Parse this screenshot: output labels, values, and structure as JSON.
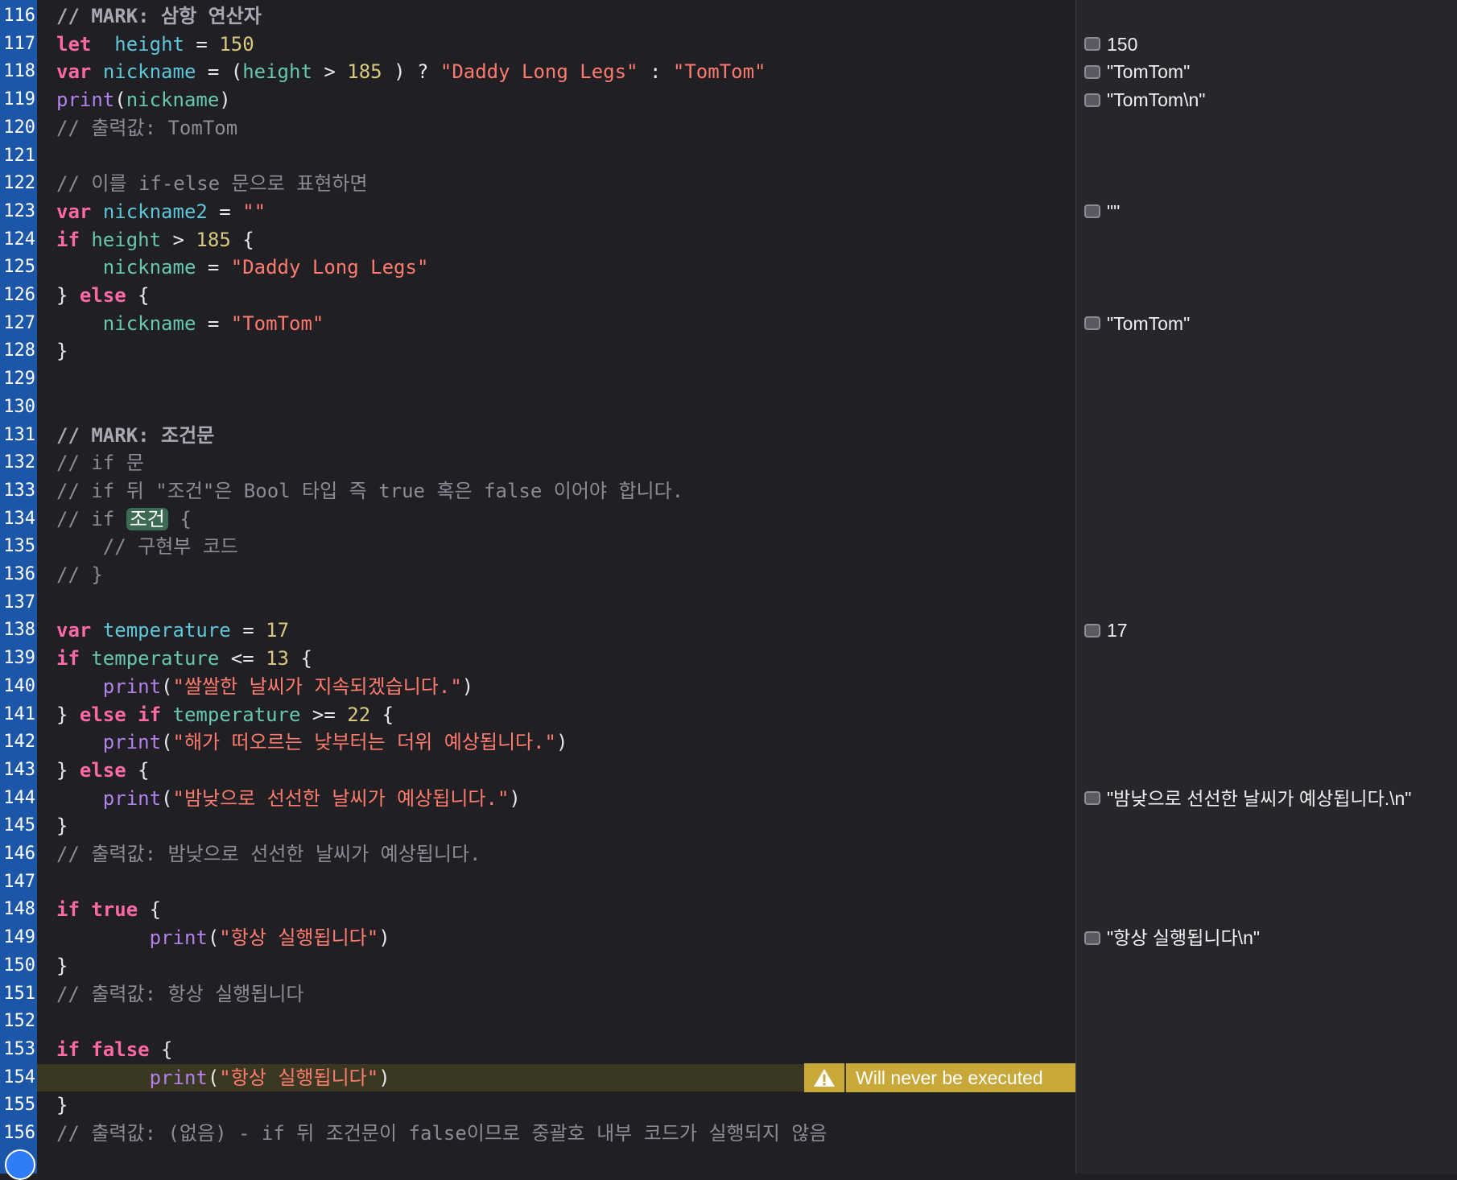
{
  "lines": [
    {
      "n": "116",
      "parts": [
        [
          "cmb",
          "// MARK: 삼항 연산자"
        ]
      ]
    },
    {
      "n": "117",
      "parts": [
        [
          "kw",
          "let"
        ],
        [
          "",
          "  "
        ],
        [
          "id",
          "height"
        ],
        [
          "",
          " = "
        ],
        [
          "num",
          "150"
        ]
      ]
    },
    {
      "n": "118",
      "parts": [
        [
          "kw",
          "var"
        ],
        [
          "",
          " "
        ],
        [
          "id",
          "nickname"
        ],
        [
          "",
          " = ("
        ],
        [
          "id2",
          "height"
        ],
        [
          "",
          " > "
        ],
        [
          "num",
          "185"
        ],
        [
          "",
          " ) ? "
        ],
        [
          "str",
          "\"Daddy Long Legs\""
        ],
        [
          "",
          " : "
        ],
        [
          "str",
          "\"TomTom\""
        ]
      ]
    },
    {
      "n": "119",
      "parts": [
        [
          "fn",
          "print"
        ],
        [
          "",
          "("
        ],
        [
          "id2",
          "nickname"
        ],
        [
          "",
          ")"
        ]
      ]
    },
    {
      "n": "120",
      "parts": [
        [
          "cm",
          "// 출력값: TomTom"
        ]
      ]
    },
    {
      "n": "121",
      "parts": []
    },
    {
      "n": "122",
      "parts": [
        [
          "cm",
          "// 이를 if-else 문으로 표현하면"
        ]
      ]
    },
    {
      "n": "123",
      "parts": [
        [
          "kw",
          "var"
        ],
        [
          "",
          " "
        ],
        [
          "id",
          "nickname2"
        ],
        [
          "",
          " = "
        ],
        [
          "str",
          "\"\""
        ]
      ]
    },
    {
      "n": "124",
      "parts": [
        [
          "kw",
          "if"
        ],
        [
          "",
          " "
        ],
        [
          "id2",
          "height"
        ],
        [
          "",
          " > "
        ],
        [
          "num",
          "185"
        ],
        [
          "",
          " {"
        ]
      ]
    },
    {
      "n": "125",
      "parts": [
        [
          "",
          "    "
        ],
        [
          "id2",
          "nickname"
        ],
        [
          "",
          " = "
        ],
        [
          "str",
          "\"Daddy Long Legs\""
        ]
      ]
    },
    {
      "n": "126",
      "parts": [
        [
          "",
          "} "
        ],
        [
          "kw",
          "else"
        ],
        [
          "",
          " {"
        ]
      ]
    },
    {
      "n": "127",
      "parts": [
        [
          "",
          "    "
        ],
        [
          "id2",
          "nickname"
        ],
        [
          "",
          " = "
        ],
        [
          "str",
          "\"TomTom\""
        ]
      ]
    },
    {
      "n": "128",
      "parts": [
        [
          "",
          "}"
        ]
      ]
    },
    {
      "n": "129",
      "parts": []
    },
    {
      "n": "130",
      "parts": []
    },
    {
      "n": "131",
      "parts": [
        [
          "cmb",
          "// MARK: 조건문"
        ]
      ]
    },
    {
      "n": "132",
      "parts": [
        [
          "cm",
          "// if 문"
        ]
      ]
    },
    {
      "n": "133",
      "parts": [
        [
          "cm",
          "// if 뒤 \"조건\"은 Bool 타입 즉 true 혹은 false 이어야 합니다."
        ]
      ]
    },
    {
      "n": "134",
      "parts": [
        [
          "cm",
          "// if "
        ],
        [
          "tag",
          "조건"
        ],
        [
          "cm",
          " {"
        ]
      ]
    },
    {
      "n": "135",
      "parts": [
        [
          "cm",
          "    // 구현부 코드"
        ]
      ]
    },
    {
      "n": "136",
      "parts": [
        [
          "cm",
          "// }"
        ]
      ]
    },
    {
      "n": "137",
      "parts": []
    },
    {
      "n": "138",
      "parts": [
        [
          "kw",
          "var"
        ],
        [
          "",
          " "
        ],
        [
          "id",
          "temperature"
        ],
        [
          "",
          " = "
        ],
        [
          "num",
          "17"
        ]
      ]
    },
    {
      "n": "139",
      "parts": [
        [
          "kw",
          "if"
        ],
        [
          "",
          " "
        ],
        [
          "id2",
          "temperature"
        ],
        [
          "",
          " <= "
        ],
        [
          "num",
          "13"
        ],
        [
          "",
          " {"
        ]
      ]
    },
    {
      "n": "140",
      "parts": [
        [
          "",
          "    "
        ],
        [
          "fn",
          "print"
        ],
        [
          "",
          "("
        ],
        [
          "str",
          "\"쌀쌀한 날씨가 지속되겠습니다.\""
        ],
        [
          "",
          ")"
        ]
      ]
    },
    {
      "n": "141",
      "parts": [
        [
          "",
          "} "
        ],
        [
          "kw",
          "else if"
        ],
        [
          "",
          " "
        ],
        [
          "id2",
          "temperature"
        ],
        [
          "",
          " >= "
        ],
        [
          "num",
          "22"
        ],
        [
          "",
          " {"
        ]
      ]
    },
    {
      "n": "142",
      "parts": [
        [
          "",
          "    "
        ],
        [
          "fn",
          "print"
        ],
        [
          "",
          "("
        ],
        [
          "str",
          "\"해가 떠오르는 낮부터는 더위 예상됩니다.\""
        ],
        [
          "",
          ")"
        ]
      ]
    },
    {
      "n": "143",
      "parts": [
        [
          "",
          "} "
        ],
        [
          "kw",
          "else"
        ],
        [
          "",
          " {"
        ]
      ]
    },
    {
      "n": "144",
      "parts": [
        [
          "",
          "    "
        ],
        [
          "fn",
          "print"
        ],
        [
          "",
          "("
        ],
        [
          "str",
          "\"밤낮으로 선선한 날씨가 예상됩니다.\""
        ],
        [
          "",
          ")"
        ]
      ]
    },
    {
      "n": "145",
      "parts": [
        [
          "",
          "}"
        ]
      ]
    },
    {
      "n": "146",
      "parts": [
        [
          "cm",
          "// 출력값: 밤낮으로 선선한 날씨가 예상됩니다."
        ]
      ]
    },
    {
      "n": "147",
      "parts": []
    },
    {
      "n": "148",
      "parts": [
        [
          "kw",
          "if"
        ],
        [
          "",
          " "
        ],
        [
          "kw",
          "true"
        ],
        [
          "",
          " {"
        ]
      ]
    },
    {
      "n": "149",
      "parts": [
        [
          "",
          "        "
        ],
        [
          "fn",
          "print"
        ],
        [
          "",
          "("
        ],
        [
          "str",
          "\"항상 실행됩니다\""
        ],
        [
          "",
          ")"
        ]
      ]
    },
    {
      "n": "150",
      "parts": [
        [
          "",
          "}"
        ]
      ]
    },
    {
      "n": "151",
      "parts": [
        [
          "cm",
          "// 출력값: 항상 실행됩니다"
        ]
      ]
    },
    {
      "n": "152",
      "parts": []
    },
    {
      "n": "153",
      "parts": [
        [
          "kw",
          "if"
        ],
        [
          "",
          " "
        ],
        [
          "kw",
          "false"
        ],
        [
          "",
          " {"
        ]
      ]
    },
    {
      "n": "154",
      "parts": [
        [
          "",
          "        "
        ],
        [
          "fn",
          "print"
        ],
        [
          "",
          "("
        ],
        [
          "str",
          "\"항상 실행됩니다\""
        ],
        [
          "",
          ")"
        ]
      ]
    },
    {
      "n": "155",
      "parts": [
        [
          "",
          "}"
        ]
      ]
    },
    {
      "n": "156",
      "parts": [
        [
          "cm",
          "// 출력값: (없음) - if 뒤 조건문이 false이므로 중괄호 내부 코드가 실행되지 않음"
        ]
      ]
    }
  ],
  "results": [
    {
      "line": "117",
      "text": "150"
    },
    {
      "line": "118",
      "text": "\"TomTom\""
    },
    {
      "line": "119",
      "text": "\"TomTom\\n\""
    },
    {
      "line": "123",
      "text": "\"\""
    },
    {
      "line": "127",
      "text": "\"TomTom\""
    },
    {
      "line": "138",
      "text": "17"
    },
    {
      "line": "144",
      "text": "\"밤낮으로 선선한 날씨가 예상됩니다.\\n\""
    },
    {
      "line": "149",
      "text": "\"항상 실행됩니다\\n\""
    }
  ],
  "warning": {
    "line": "154",
    "text": "Will never be executed",
    "icon": "warning-triangle-icon"
  },
  "colors": {
    "gutter": "#1c56a8",
    "editor": "#1f1f24",
    "results": "#27272b",
    "warning": "#c9a83a"
  }
}
